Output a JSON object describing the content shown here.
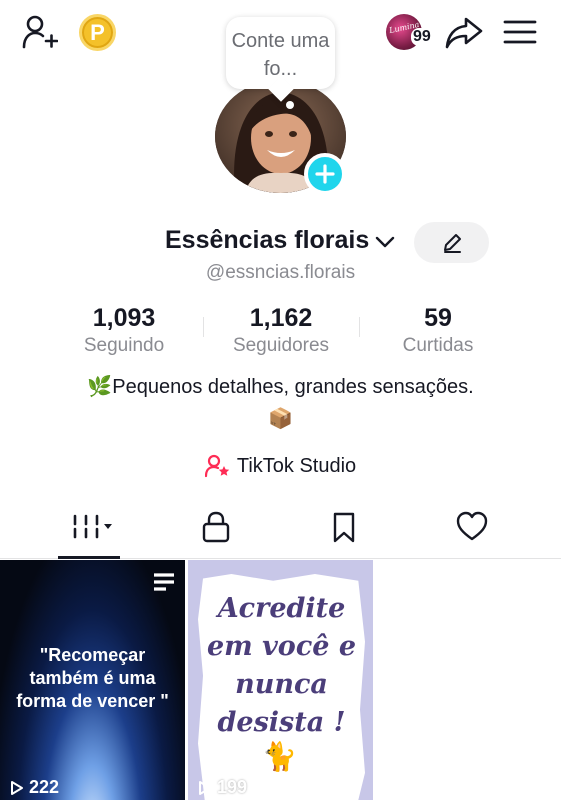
{
  "header": {
    "add_user_icon": "add-user-icon",
    "coin_label": "P",
    "story_badge_count": "99",
    "share_icon": "share-icon",
    "menu_icon": "hamburger-menu-icon"
  },
  "note_bubble": {
    "text": "Conte uma fo..."
  },
  "profile": {
    "display_name": "Essências florais",
    "handle": "@essncias.florais",
    "bio": "🌿Pequenos detalhes, grandes sensações.",
    "bio_emoji": "📦",
    "studio_label": "TikTok Studio"
  },
  "stats": [
    {
      "value": "1,093",
      "label": "Seguindo"
    },
    {
      "value": "1,162",
      "label": "Seguidores"
    },
    {
      "value": "59",
      "label": "Curtidas"
    }
  ],
  "tabs": [
    "videos-grid",
    "private",
    "saved",
    "liked"
  ],
  "videos": [
    {
      "caption": "\"Recomeçar também é uma forma de vencer \"",
      "views": "222"
    },
    {
      "caption": "Acredite em você e nunca desista !",
      "views": "199",
      "emoji": "🐈"
    }
  ],
  "colors": {
    "accent_cyan": "#20d5ec",
    "coin_gold": "#f4c12a",
    "studio_pink": "#fe2c55"
  }
}
